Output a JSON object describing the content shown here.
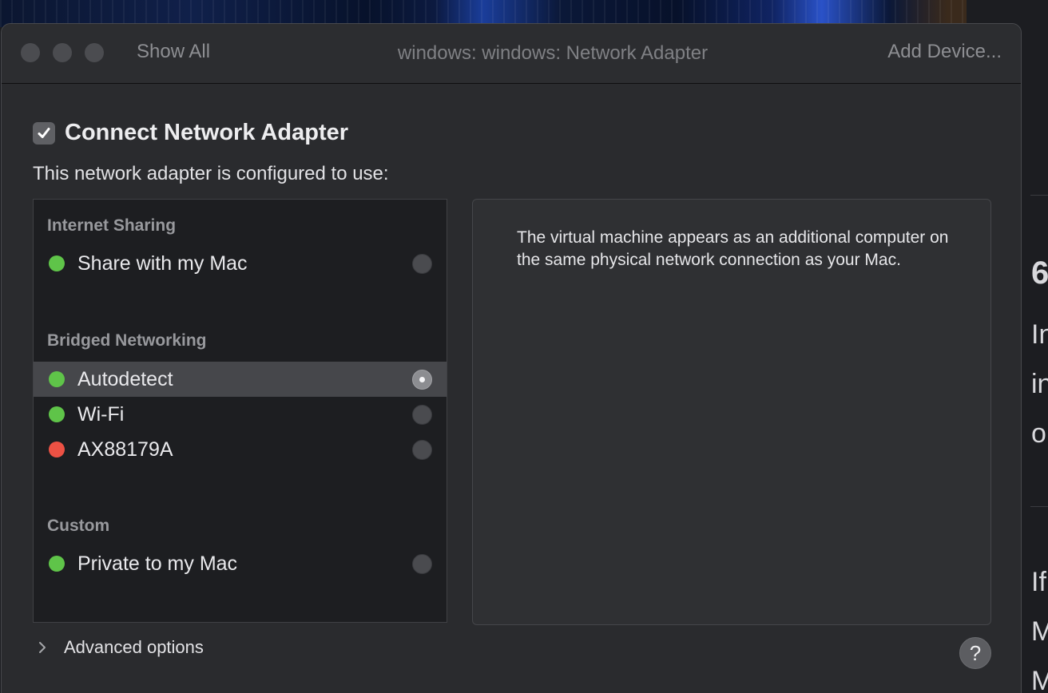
{
  "window": {
    "title": "windows: windows: Network Adapter",
    "show_all": "Show All",
    "add_device": "Add Device..."
  },
  "connect": {
    "label": "Connect Network Adapter",
    "checked": true
  },
  "configured_text": "This network adapter is configured to use:",
  "groups": [
    {
      "header": "Internet Sharing",
      "items": [
        {
          "label": "Share with my Mac",
          "status": "green",
          "selected": false
        }
      ]
    },
    {
      "header": "Bridged Networking",
      "items": [
        {
          "label": "Autodetect",
          "status": "green",
          "selected": true
        },
        {
          "label": "Wi-Fi",
          "status": "green",
          "selected": false
        },
        {
          "label": "AX88179A",
          "status": "red",
          "selected": false
        }
      ]
    },
    {
      "header": "Custom",
      "items": [
        {
          "label": "Private to my Mac",
          "status": "green",
          "selected": false
        }
      ]
    }
  ],
  "description": "The virtual machine appears as an additional computer on the same physical network connection as your Mac.",
  "advanced_options": "Advanced options",
  "help": "?",
  "background_page": {
    "fragments": [
      "6",
      "In",
      "in",
      "o",
      "If",
      "M",
      "M"
    ]
  },
  "colors": {
    "status_green": "#5fc449",
    "status_red": "#ec5144",
    "window_bg": "#2a2b2e"
  }
}
